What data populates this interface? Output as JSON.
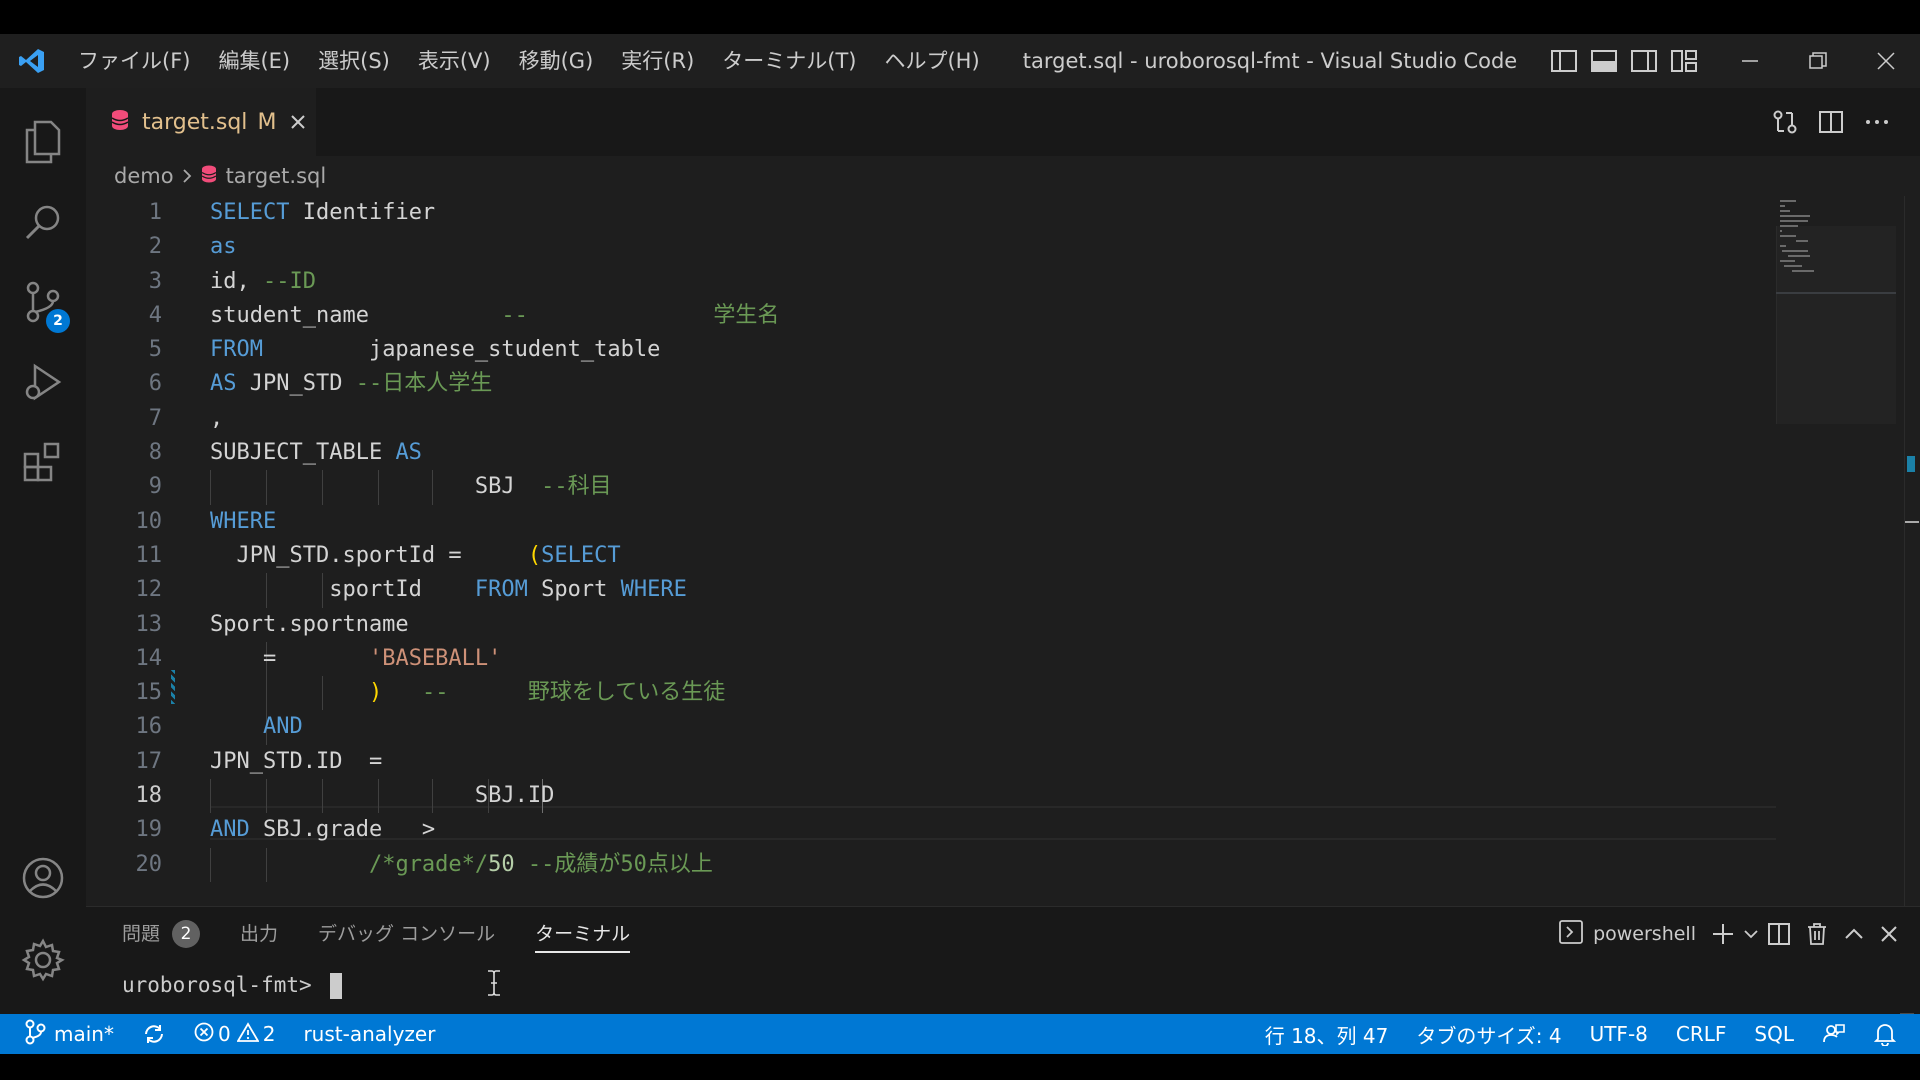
{
  "titlebar": {
    "menu": [
      "ファイル(F)",
      "編集(E)",
      "選択(S)",
      "表示(V)",
      "移動(G)",
      "実行(R)",
      "ターミナル(T)",
      "ヘルプ(H)"
    ],
    "title": "target.sql - uroborosql-fmt - Visual Studio Code"
  },
  "activitybar": {
    "scm_badge": "2"
  },
  "tab": {
    "title": "target.sql",
    "modified": "M"
  },
  "breadcrumb": {
    "folder": "demo",
    "file": "target.sql"
  },
  "editor": {
    "active_line": 18,
    "lines": [
      {
        "n": "1",
        "tokens": [
          [
            "kw",
            "SELECT"
          ],
          [
            "plain",
            " Identifier"
          ]
        ]
      },
      {
        "n": "2",
        "tokens": [
          [
            "kw",
            "as"
          ]
        ]
      },
      {
        "n": "3",
        "tokens": [
          [
            "plain",
            "id, "
          ],
          [
            "cm",
            "--ID"
          ]
        ]
      },
      {
        "n": "4",
        "tokens": [
          [
            "plain",
            "student_name          "
          ],
          [
            "cm",
            "--              学生名"
          ]
        ]
      },
      {
        "n": "5",
        "tokens": [
          [
            "kw",
            "FROM"
          ],
          [
            "plain",
            "        japanese_student_table"
          ]
        ]
      },
      {
        "n": "6",
        "tokens": [
          [
            "kw",
            "AS"
          ],
          [
            "plain",
            " JPN_STD "
          ],
          [
            "cm",
            "--日本人学生"
          ]
        ]
      },
      {
        "n": "7",
        "tokens": [
          [
            "plain",
            ","
          ]
        ]
      },
      {
        "n": "8",
        "tokens": [
          [
            "plain",
            "SUBJECT_TABLE "
          ],
          [
            "kw",
            "AS"
          ]
        ]
      },
      {
        "n": "9",
        "tokens": [
          [
            "plain",
            "                    SBJ  "
          ],
          [
            "cm",
            "--科目"
          ]
        ]
      },
      {
        "n": "10",
        "tokens": [
          [
            "kw",
            "WHERE"
          ]
        ]
      },
      {
        "n": "11",
        "tokens": [
          [
            "plain",
            "  JPN_STD.sportId =     "
          ],
          [
            "par",
            "("
          ],
          [
            "kw",
            "SELECT"
          ]
        ]
      },
      {
        "n": "12",
        "tokens": [
          [
            "plain",
            "         sportId    "
          ],
          [
            "kw",
            "FROM"
          ],
          [
            "plain",
            " Sport "
          ],
          [
            "kw",
            "WHERE"
          ]
        ]
      },
      {
        "n": "13",
        "tokens": [
          [
            "plain",
            "Sport.sportname"
          ]
        ]
      },
      {
        "n": "14",
        "tokens": [
          [
            "plain",
            "    =       "
          ],
          [
            "str",
            "'BASEBALL'"
          ]
        ]
      },
      {
        "n": "15",
        "tokens": [
          [
            "plain",
            "            "
          ],
          [
            "par",
            ")"
          ],
          [
            "plain",
            "   "
          ],
          [
            "cm",
            "--      野球をしている生徒"
          ]
        ]
      },
      {
        "n": "16",
        "tokens": [
          [
            "plain",
            "    "
          ],
          [
            "kw",
            "AND"
          ]
        ]
      },
      {
        "n": "17",
        "tokens": [
          [
            "plain",
            "JPN_STD.ID  ="
          ]
        ]
      },
      {
        "n": "18",
        "tokens": [
          [
            "plain",
            "                    SBJ.ID"
          ]
        ]
      },
      {
        "n": "19",
        "tokens": [
          [
            "kw",
            "AND"
          ],
          [
            "plain",
            " SBJ.grade   >"
          ]
        ]
      },
      {
        "n": "20",
        "tokens": [
          [
            "plain",
            "            "
          ],
          [
            "cm",
            "/*grade*/"
          ],
          [
            "num",
            "50"
          ],
          [
            "plain",
            " "
          ],
          [
            "cm",
            "--成績が50点以上"
          ]
        ]
      }
    ]
  },
  "panel": {
    "tabs": [
      "問題",
      "出力",
      "デバッグ コンソール",
      "ターミナル"
    ],
    "problems_count": "2",
    "active_tab": "ターミナル",
    "shell": "powershell",
    "prompt": "uroborosql-fmt> "
  },
  "statusbar": {
    "branch": "main*",
    "errors": "0",
    "warnings": "2",
    "extension": "rust-analyzer",
    "position": "行 18、列 47",
    "tab_size": "タブのサイズ: 4",
    "encoding": "UTF-8",
    "eol": "CRLF",
    "language": "SQL"
  },
  "colors": {
    "accent": "#0078d4",
    "keyword": "#569cd6",
    "comment": "#6a9955",
    "string": "#ce9178",
    "modified": "#e2c08d",
    "sql_icon": "#f14c7a"
  }
}
